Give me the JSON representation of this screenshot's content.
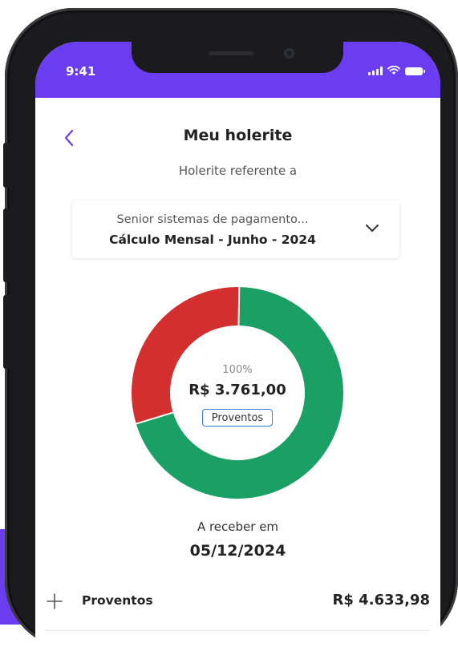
{
  "status_bar": {
    "time": "9:41"
  },
  "header": {
    "title": "Meu holerite",
    "subtitle": "Holerite referente a"
  },
  "selector": {
    "company": "Senior sistemas de pagamento...",
    "period": "Cálculo Mensal - Junho - 2024"
  },
  "donut": {
    "percent_label": "100%",
    "amount": "R$ 3.761,00",
    "tag": "Proventos",
    "segments": [
      {
        "color": "#d32f2f",
        "fraction": 0.3
      },
      {
        "color": "#1aa064",
        "fraction": 0.7
      }
    ]
  },
  "payment": {
    "label": "A receber em",
    "date": "05/12/2024"
  },
  "summary_rows": [
    {
      "label": "Proventos",
      "value": "R$ 4.633,98"
    }
  ],
  "colors": {
    "accent": "#6a3df0",
    "back_arrow": "#6a3df0"
  }
}
